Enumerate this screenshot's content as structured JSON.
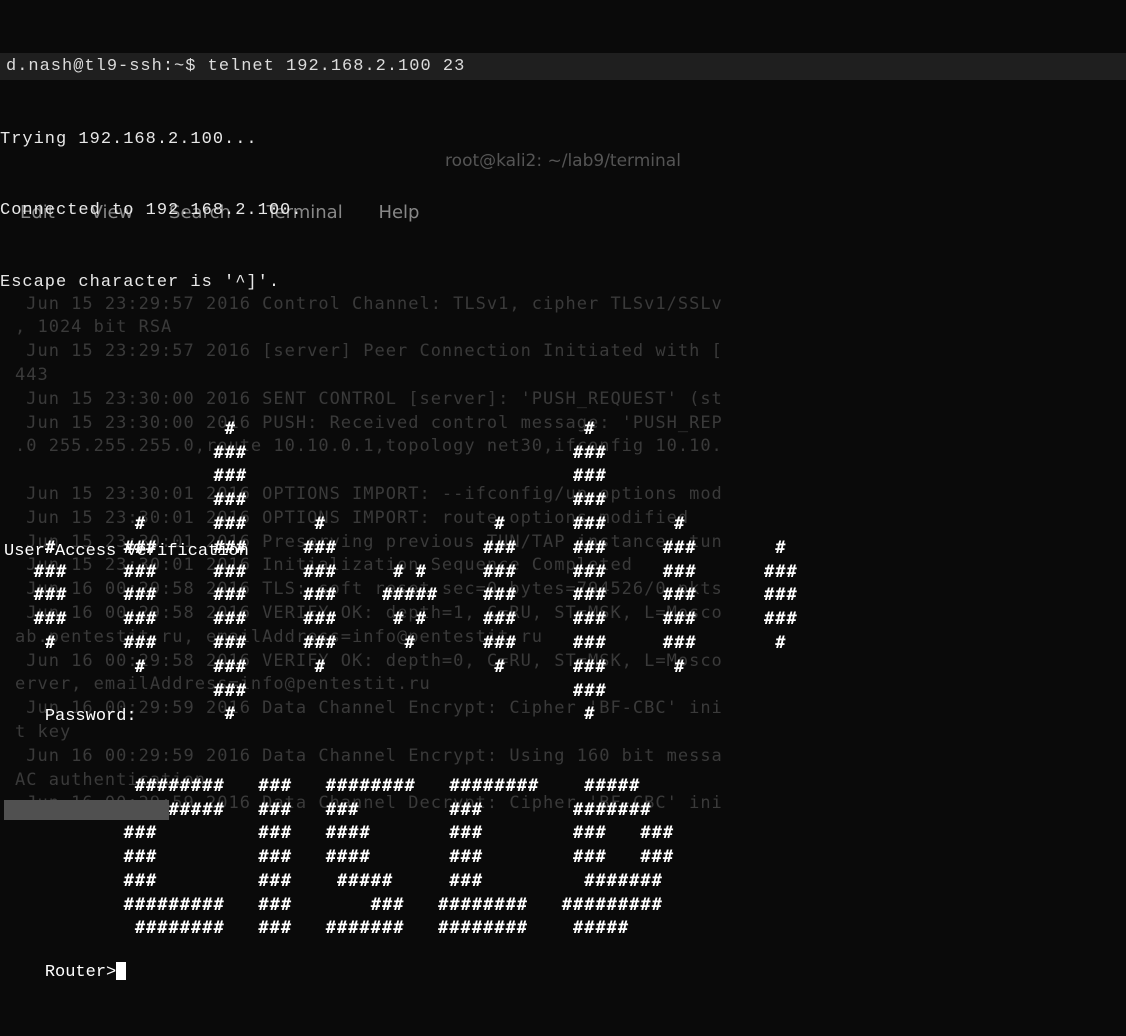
{
  "bg_window": {
    "title": "root@kali2: ~/lab9/terminal",
    "menu": [
      "Edit",
      "View",
      "Search",
      "Terminal",
      "Help"
    ]
  },
  "bg_log": " Jun 15 23:29:57 2016 Control Channel: TLSv1, cipher TLSv1/SSLv\n, 1024 bit RSA\n Jun 15 23:29:57 2016 [server] Peer Connection Initiated with [\n443\n Jun 15 23:30:00 2016 SENT CONTROL [server]: 'PUSH_REQUEST' (st\n Jun 15 23:30:00 2016 PUSH: Received control message: 'PUSH_REP\n.0 255.255.255.0,route 10.10.0.1,topology net30,ifconfig 10.10.\n\n Jun 15 23:30:01 2016 OPTIONS IMPORT: --ifconfig/up options mod\n Jun 15 23:30:01 2016 OPTIONS IMPORT: route options modified\n Jun 15 23:30:01 2016 Preserving previous TUN/TAP instance: tun\n Jun 15 23:30:01 2016 Initialization Sequence Completed\n Jun 16 00:29:58 2016 TLS: soft reset sec=0 bytes=794526/0 pkts\n Jun 16 00:29:58 2016 VERIFY OK: depth=1, C=RU, ST=MSK, L=Mosco\nab.pentestit.ru, emailAddress=info@pentestit.ru\n Jun 16 00:29:58 2016 VERIFY OK: depth=0, C=RU, ST=MSK, L=Mosco\nerver, emailAddress=info@pentestit.ru\n Jun 16 00:29:59 2016 Data Channel Encrypt: Cipher 'BF-CBC' ini\nt key\n Jun 16 00:29:59 2016 Data Channel Encrypt: Using 160 bit messa\nAC authentication\n Jun 16 00:29:59 2016 Data Channel Decrypt: Cipher 'BF-CBC' ini",
  "fg": {
    "prompt_line": "d.nash@tl9-ssh:~$ telnet 192.168.2.100 23",
    "connect": [
      "Trying 192.168.2.100...",
      "Connected to 192.168.2.100.",
      "Escape character is '^]'."
    ]
  },
  "ascii_banner": "                    #                               #\n                   ###                             ###\n                   ###                             ###\n                   ###                             ###\n            #      ###      #               #      ###      #\n    #      ###     ###     ###             ###     ###     ###       #\n   ###     ###     ###     ###     # #     ###     ###     ###      ###\n   ###     ###     ###     ###    #####    ###     ###     ###      ###\n   ###     ###     ###     ###     # #     ###     ###     ###      ###\n    #      ###     ###     ###      #      ###     ###     ###       #\n            #      ###      #               #      ###      #\n                   ###                             ###\n                    #                               #\n\n\n            ########   ###   ########   ########    #####\n           #########   ###   ###        ###        #######\n           ###         ###   ####       ###        ###   ###\n           ###         ###   ####       ###        ###   ###\n           ###         ###    #####     ###         #######\n           #########   ###       ###   ########   #########\n            ########   ###   #######   ########    #####",
  "footer": {
    "uav": "User Access Verification",
    "pw_label": "Password:",
    "prompt": "Router>"
  }
}
